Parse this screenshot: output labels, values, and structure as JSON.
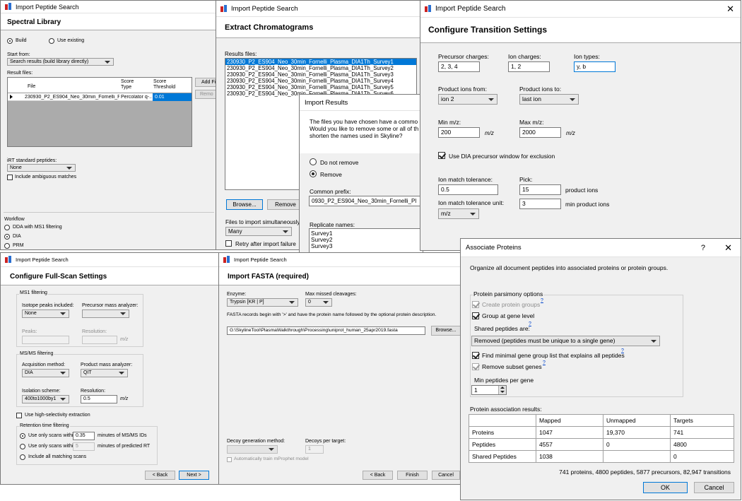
{
  "w1": {
    "title": "Import Peptide Search",
    "header": "Spectral Library",
    "build": "Build",
    "use_existing": "Use existing",
    "start_from_label": "Start from:",
    "start_from_value": "Search results (build library directly)",
    "result_files_label": "Result files:",
    "col_file": "File",
    "col_score_type": "Score Type",
    "col_score_threshold": "Score Threshold",
    "row_file": "230930_P2_ES904_Neo_30min_Fornelli_Pla...",
    "row_score_type": "Percolator q-...",
    "row_threshold": "0.01",
    "add_files": "Add Fil",
    "remove": "Remo",
    "irt_label": "iRT standard peptides:",
    "irt_value": "None",
    "include_ambiguous": "Include ambiguous matches",
    "workflow_label": "Workflow",
    "wf_dda": "DDA with MS1 filtering",
    "wf_dia": "DIA",
    "wf_prm": "PRM"
  },
  "w2": {
    "title": "Import Peptide Search",
    "header": "Extract Chromatograms",
    "results_label": "Results files:",
    "files": [
      "230930_P2_ES904_Neo_30min_Fornelli_Plasma_DIA1Th_Survey1",
      "230930_P2_ES904_Neo_30min_Fornelli_Plasma_DIA1Th_Survey2",
      "230930_P2_ES904_Neo_30min_Fornelli_Plasma_DIA1Th_Survey3",
      "230930_P2_ES904_Neo_30min_Fornelli_Plasma_DIA1Th_Survey4",
      "230930_P2_ES904_Neo_30min_Fornelli_Plasma_DIA1Th_Survey5",
      "230930_P2_ES904_Neo_30min_Fornelli_Plasma_DIA1Th_Survey6"
    ],
    "browse": "Browse...",
    "remove": "Remove",
    "simultaneous_label": "Files to import simultaneously:",
    "simultaneous_value": "Many",
    "retry": "Retry after import failure"
  },
  "w3": {
    "title": "Import Results",
    "message": [
      "The files you have chosen have a commo",
      "Would you like to remove some or all of th",
      "shorten the names used in Skyline?"
    ],
    "do_not_remove": "Do not remove",
    "remove": "Remove",
    "common_prefix_label": "Common prefix:",
    "common_prefix_value": "0930_P2_ES904_Neo_30min_Fornelli_Pl",
    "replicate_label": "Replicate names:",
    "replicates": [
      "Survey1",
      "Survey2",
      "Survey3"
    ]
  },
  "w4": {
    "title": "Import Peptide Search",
    "close": "✕",
    "header": "Configure Transition Settings",
    "precursor_charges_label": "Precursor charges:",
    "precursor_charges_value": "2, 3, 4",
    "ion_charges_label": "Ion charges:",
    "ion_charges_value": "1, 2",
    "ion_types_label": "Ion types:",
    "ion_types_value": "y, b",
    "product_from_label": "Product ions from:",
    "product_from_value": "ion 2",
    "product_to_label": "Product ions to:",
    "product_to_value": "last ion",
    "min_mz_label": "Min m/z:",
    "min_mz_value": "200",
    "max_mz_label": "Max m/z:",
    "max_mz_value": "2000",
    "mz_unit": "m/z",
    "use_dia": "Use DIA precursor window for exclusion",
    "tol_label": "Ion match tolerance:",
    "tol_value": "0.5",
    "pick_label": "Pick:",
    "pick_value": "15",
    "product_ions": "product ions",
    "tol_unit_label": "Ion match tolerance unit:",
    "tol_unit_value": "m/z",
    "min_product_value": "3",
    "min_product_ions": "min product ions"
  },
  "w5": {
    "title": "Import Peptide Search",
    "header": "Configure Full-Scan Settings",
    "ms1_label": "MS1 filtering",
    "isotope_label": "Isotope peaks included:",
    "isotope_value": "None",
    "precursor_analyzer_label": "Precursor mass analyzer:",
    "peaks_label": "Peaks:",
    "resolution_label": "Resolution:",
    "mz": "m/z",
    "msms_label": "MS/MS filtering",
    "acq_label": "Acquisition method:",
    "acq_value": "DIA",
    "product_analyzer_label": "Product mass analyzer:",
    "product_analyzer_value": "QIT",
    "iso_scheme_label": "Isolation scheme:",
    "iso_scheme_value": "400to1000by1",
    "resolution2_value": "0.5",
    "high_sel": "Use high-selectivity extraction",
    "rt_label": "Retention time filtering",
    "rt_opt1": "Use only scans within",
    "rt_opt1_value": "0.35",
    "rt_opt1_suffix": "minutes of MS/MS IDs",
    "rt_opt2": "Use only scans within",
    "rt_opt2_value": "5",
    "rt_opt2_suffix": "minutes of predicted RT",
    "rt_opt3": "Include all matching scans",
    "back": "< Back",
    "next": "Next >"
  },
  "w6": {
    "title": "Import Peptide Search",
    "header": "Import FASTA (required)",
    "enzyme_label": "Enzyme:",
    "enzyme_value": "Trypsin [KR | P]",
    "missed_label": "Max missed cleavages:",
    "missed_value": "0",
    "fasta_note": "FASTA records begin with '>' and have the protein name followed by the optional protein description.",
    "fasta_path": "G:\\SkylineTool\\PlasmaWalkthrough\\Processing\\uniprot_human_25apr2019.fasta",
    "browse": "Browse...",
    "decoy_label": "Decoy generation method:",
    "decoys_label": "Decoys per target:",
    "decoys_value": "1",
    "auto_train": "Automatically train mProphet model",
    "back": "< Back",
    "finish": "Finish",
    "cancel": "Cancel"
  },
  "w7": {
    "title": "Associate Proteins",
    "help": "?",
    "close": "✕",
    "intro": "Organize all document peptides into associated proteins or protein groups.",
    "parsimony_label": "Protein parsimony options",
    "create_groups": "Create protein groups",
    "group_gene": "Group at gene level",
    "shared_label": "Shared peptides are:",
    "shared_value": "Removed (peptides must be unique to a single gene)",
    "find_minimal": "Find minimal gene group list that explains all peptides",
    "remove_subset": "Remove subset genes",
    "min_peptides_label": "Min peptides per gene",
    "min_peptides_value": "1",
    "help_mark": "?",
    "results_label": "Protein association results:",
    "table": {
      "headers": [
        "",
        "Mapped",
        "Unmapped",
        "Targets"
      ],
      "rows": [
        [
          "Proteins",
          "1047",
          "19,370",
          "741"
        ],
        [
          "Peptides",
          "4557",
          "0",
          "4800"
        ],
        [
          "Shared Peptides",
          "1038",
          "",
          "0"
        ]
      ]
    },
    "summary": "741 proteins, 4800 peptides, 5877 precursors, 82,947 transitions",
    "ok": "OK",
    "cancel": "Cancel"
  }
}
